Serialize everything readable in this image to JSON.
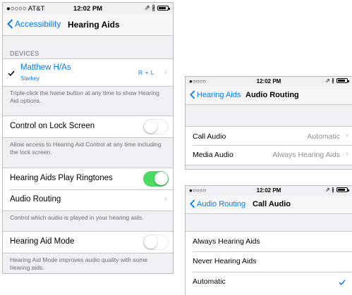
{
  "main_screen": {
    "status": {
      "carrier": "●○○○○ AT&T",
      "time": "12:02 PM",
      "icons": "⇗ ∦"
    },
    "nav": {
      "back_label": "Accessibility",
      "title": "Hearing Aids"
    },
    "devices_header": "DEVICES",
    "device": {
      "name": "Matthew H/As",
      "maker": "Starkey",
      "channels": "R + L"
    },
    "device_footer": "Triple-click the home button at any time to show Hearing Aid options.",
    "lock_screen": {
      "label": "Control on Lock Screen",
      "on": false
    },
    "lock_footer": "Allow access to Hearing Aid Control at any time including the lock screen.",
    "ringtones": {
      "label": "Hearing Aids Play Ringtones",
      "on": true
    },
    "audio_routing_label": "Audio Routing",
    "routing_footer": "Control which audio is played in your hearing aids.",
    "hearing_aid_mode": {
      "label": "Hearing Aid Mode",
      "on": false
    },
    "mode_footer": "Hearing Aid Mode improves audio quality with some hearing aids."
  },
  "routing_screen": {
    "status": {
      "carrier": "●○○○○",
      "time": "12:02 PM",
      "icons": "⇗ ∦"
    },
    "nav": {
      "back_label": "Hearing Aids",
      "title": "Audio Routing"
    },
    "rows": [
      {
        "label": "Call Audio",
        "value": "Automatic"
      },
      {
        "label": "Media Audio",
        "value": "Always Hearing Aids"
      }
    ]
  },
  "call_audio_screen": {
    "status": {
      "carrier": "●○○○○",
      "time": "12:02 PM",
      "icons": "⇗ ∦"
    },
    "nav": {
      "back_label": "Audio Routing",
      "title": "Call Audio"
    },
    "options": [
      "Always Hearing Aids",
      "Never Hearing Aids",
      "Automatic"
    ],
    "selected_index": 2
  },
  "colors": {
    "accent": "#007aff",
    "toggle_on": "#4cd964",
    "background": "#efeff4"
  }
}
